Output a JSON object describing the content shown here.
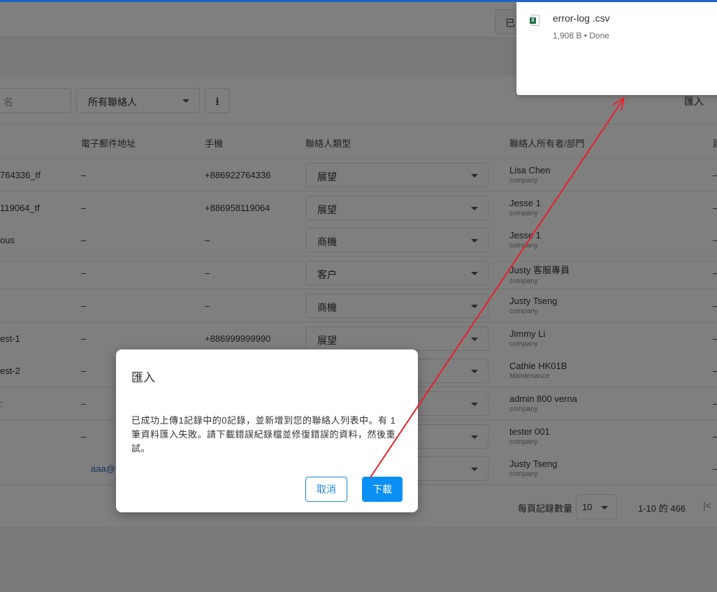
{
  "header": {
    "button_partial": "已"
  },
  "toolbar": {
    "search_partial": "名",
    "filter": "所有聯絡人",
    "import": "匯入"
  },
  "columns": {
    "email": "電子郵件地址",
    "mobile": "手機",
    "type": "聯絡人類型",
    "owner": "聯絡人所有者/部門",
    "last_partial": "建"
  },
  "rows": [
    {
      "name": "764336_tf",
      "email": "–",
      "mobile": "+886922764336",
      "type": "展望",
      "owner": "Lisa Chen",
      "dept": "company",
      "last": "–"
    },
    {
      "name": "119064_tf",
      "email": "–",
      "mobile": "+886958119064",
      "type": "展望",
      "owner": "Jesse 1",
      "dept": "company",
      "last": "–"
    },
    {
      "name": "ous",
      "email": "–",
      "mobile": "–",
      "type": "商機",
      "owner": "Jesse 1",
      "dept": "company",
      "last": "–"
    },
    {
      "name": "",
      "email": "–",
      "mobile": "–",
      "type": "客户",
      "owner": "Justy 客服專員",
      "dept": "company",
      "last": "–"
    },
    {
      "name": "",
      "email": "–",
      "mobile": "–",
      "type": "商機",
      "owner": "Justy Tseng",
      "dept": "company",
      "last": "–"
    },
    {
      "name": "est-1",
      "email": "–",
      "mobile": "+886999999990",
      "type": "展望",
      "owner": "Jimmy Li",
      "dept": "company",
      "last": "–"
    },
    {
      "name": "est-2",
      "email": "–",
      "mobile": "",
      "type": "",
      "owner": "Cathie HK01B",
      "dept": "Maintenance",
      "last": "–"
    },
    {
      "name": ":",
      "email": "–",
      "mobile": "",
      "type": "",
      "owner": "admin 800 verna",
      "dept": "company",
      "last": "–"
    },
    {
      "name": "",
      "email": "–",
      "mobile": "",
      "type": "",
      "owner": "tester 001",
      "dept": "company",
      "last": "–"
    },
    {
      "name": "",
      "email": "aaa@",
      "mobile": "",
      "type": "",
      "owner": "Justy Tseng",
      "dept": "company",
      "last": "–"
    }
  ],
  "pagination": {
    "per_page_label": "每頁記錄數量",
    "per_page": "10",
    "range": "1-10 的 466"
  },
  "dialog": {
    "title": "匯入",
    "message": "已成功上傳1記錄中的0記錄，並新增到您的聯絡人列表中。有 1 筆資料匯入失敗。請下載錯誤紀錄檔並修復錯誤的資料，然後重試。",
    "cancel": "取消",
    "download": "下載"
  },
  "download_panel": {
    "filename": "error-log .csv",
    "meta": "1,908 B • Done"
  },
  "colors": {
    "accent": "#0a8ff5",
    "annotation": "#e8202a",
    "topbar": "#1e63c4"
  }
}
